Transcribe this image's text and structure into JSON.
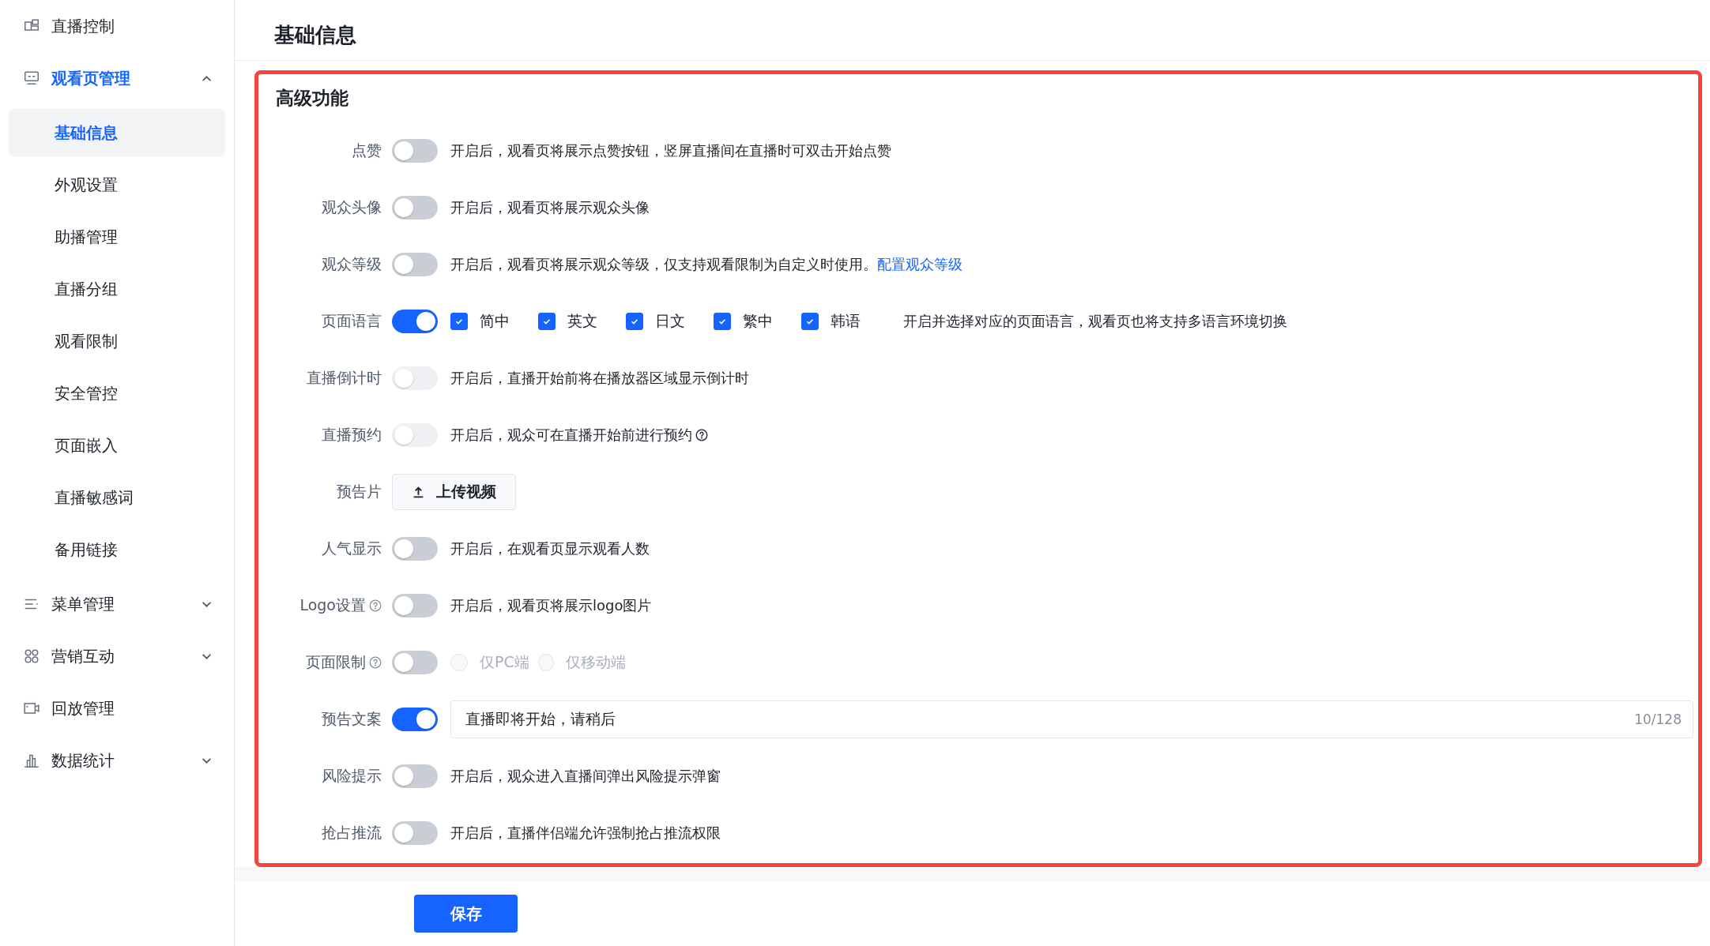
{
  "sidebar": {
    "items": [
      {
        "label": "直播控制",
        "selected": false
      },
      {
        "label": "观看页管理",
        "selected": true,
        "expanded": true,
        "children": [
          {
            "label": "基础信息",
            "selected": true
          },
          {
            "label": "外观设置",
            "selected": false
          },
          {
            "label": "助播管理",
            "selected": false
          },
          {
            "label": "直播分组",
            "selected": false
          },
          {
            "label": "观看限制",
            "selected": false
          },
          {
            "label": "安全管控",
            "selected": false
          },
          {
            "label": "页面嵌入",
            "selected": false
          },
          {
            "label": "直播敏感词",
            "selected": false
          },
          {
            "label": "备用链接",
            "selected": false
          }
        ]
      },
      {
        "label": "菜单管理",
        "selected": false,
        "expanded": false
      },
      {
        "label": "营销互动",
        "selected": false,
        "expanded": false
      },
      {
        "label": "回放管理",
        "selected": false
      },
      {
        "label": "数据统计",
        "selected": false,
        "expanded": false
      }
    ]
  },
  "page_title": "基础信息",
  "section": {
    "title": "高级功能",
    "rows": [
      {
        "kind": "toggle",
        "label": "点赞",
        "on": false,
        "disabled": false,
        "description": "开启后，观看页将展示点赞按钮，竖屏直播间在直播时可双击开始点赞"
      },
      {
        "kind": "toggle",
        "label": "观众头像",
        "on": false,
        "disabled": false,
        "description": "开启后，观看页将展示观众头像"
      },
      {
        "kind": "toggle",
        "label": "观众等级",
        "on": false,
        "disabled": false,
        "description": "开启后，观看页将展示观众等级，仅支持观看限制为自定义时使用。",
        "link": "配置观众等级"
      },
      {
        "kind": "languages",
        "label": "页面语言",
        "on": true,
        "disabled": false,
        "options": [
          {
            "label": "简中",
            "checked": true
          },
          {
            "label": "英文",
            "checked": true
          },
          {
            "label": "日文",
            "checked": true
          },
          {
            "label": "繁中",
            "checked": true
          },
          {
            "label": "韩语",
            "checked": true
          }
        ],
        "description": "开启并选择对应的页面语言，观看页也将支持多语言环境切换"
      },
      {
        "kind": "toggle",
        "label": "直播倒计时",
        "on": false,
        "disabled": true,
        "description": "开启后，直播开始前将在播放器区域显示倒计时"
      },
      {
        "kind": "toggle",
        "label": "直播预约",
        "on": false,
        "disabled": true,
        "description": "开启后，观众可在直播开始前进行预约",
        "description_help": true
      },
      {
        "kind": "upload",
        "label": "预告片",
        "button": "上传视频"
      },
      {
        "kind": "toggle",
        "label": "人气显示",
        "on": false,
        "disabled": false,
        "description": "开启后，在观看页显示观看人数"
      },
      {
        "kind": "toggle",
        "label": "Logo设置",
        "help": true,
        "on": false,
        "disabled": false,
        "description": "开启后，观看页将展示logo图片"
      },
      {
        "kind": "radios",
        "label": "页面限制",
        "help": true,
        "on": false,
        "disabled": false,
        "options": [
          {
            "label": "仅PC端",
            "selected": false,
            "disabled": true
          },
          {
            "label": "仅移动端",
            "selected": false,
            "disabled": true
          }
        ]
      },
      {
        "kind": "text",
        "label": "预告文案",
        "on": true,
        "disabled": false,
        "value": "直播即将开始，请稍后",
        "counter": "10/128"
      },
      {
        "kind": "toggle",
        "label": "风险提示",
        "on": false,
        "disabled": false,
        "description": "开启后，观众进入直播间弹出风险提示弹窗"
      },
      {
        "kind": "toggle",
        "label": "抢占推流",
        "on": false,
        "disabled": false,
        "description": "开启后，直播伴侣端允许强制抢占推流权限"
      }
    ]
  },
  "save_button": "保存"
}
